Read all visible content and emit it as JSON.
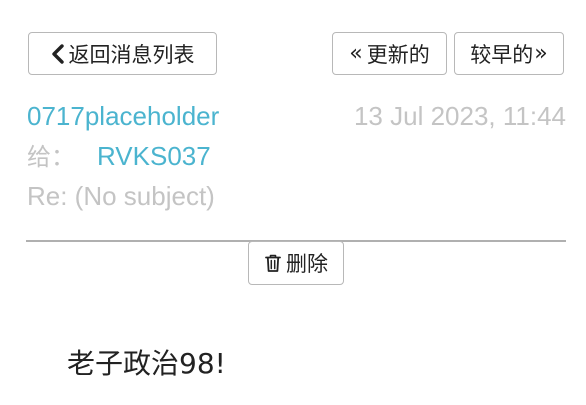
{
  "toolbar": {
    "back_label": "返回消息列表",
    "newer_label": "更新的",
    "older_label": "较早的",
    "back_icon": "chevron-left-icon",
    "newer_icon": "double-chevron-left-icon",
    "older_icon": "double-chevron-right-icon"
  },
  "message": {
    "sender": "0717placeholder",
    "date": "13 Jul 2023, 11:44",
    "to_label": "给：",
    "to_value": "RVKS037",
    "subject": "Re: (No subject)",
    "body": "老子政治98!"
  },
  "actions": {
    "delete_label": "删除",
    "delete_icon": "trash-icon"
  },
  "colors": {
    "link": "#4bb4cf",
    "muted": "#c4c4c4",
    "border": "#b8b8b8",
    "text": "#222222"
  }
}
